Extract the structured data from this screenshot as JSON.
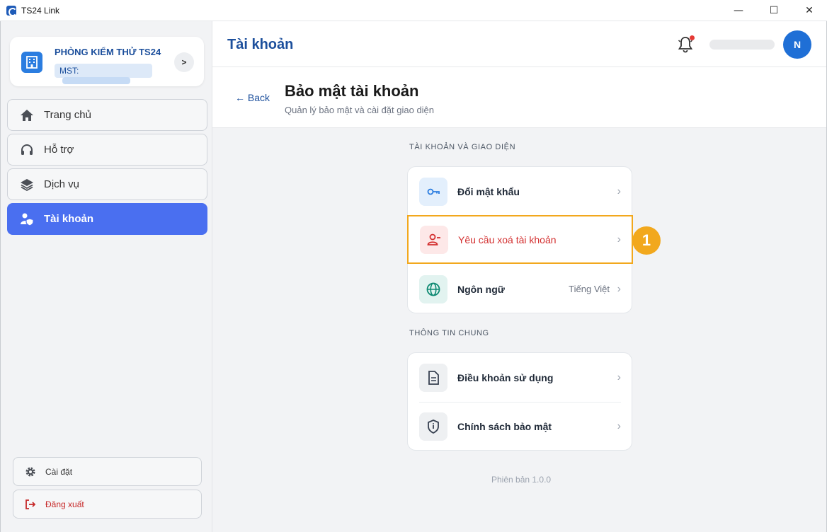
{
  "window": {
    "title": "TS24 Link",
    "minimize": "—",
    "maximize": "☐",
    "close": "✕"
  },
  "sidebar": {
    "org_name": "PHÒNG KIỂM THỬ TS24",
    "org_mst_label": "MST:",
    "org_arrow": ">",
    "items": [
      {
        "label": "Trang chủ",
        "icon": "home-icon"
      },
      {
        "label": "Hỗ trợ",
        "icon": "headset-icon"
      },
      {
        "label": "Dịch vụ",
        "icon": "layers-icon"
      },
      {
        "label": "Tài khoản",
        "icon": "user-shield-icon",
        "active": true
      }
    ],
    "settings_label": "Cài đặt",
    "logout_label": "Đăng xuất"
  },
  "header": {
    "title": "Tài khoản",
    "avatar_initial": "N"
  },
  "subheader": {
    "back_label": "← Back",
    "page_title": "Bảo mật tài khoản",
    "page_subtitle": "Quản lý bảo mật và cài đặt giao diện"
  },
  "sections": [
    {
      "label": "TÀI KHOẢN VÀ GIAO DIỆN",
      "rows": [
        {
          "label": "Đổi mật khẩu",
          "icon": "key-icon"
        },
        {
          "label": "Yêu cầu xoá tài khoản",
          "icon": "user-remove-icon",
          "highlighted": true
        },
        {
          "label": "Ngôn ngữ",
          "value": "Tiếng Việt",
          "icon": "globe-icon"
        }
      ]
    },
    {
      "label": "THÔNG TIN CHUNG",
      "rows": [
        {
          "label": "Điều khoản sử dụng",
          "icon": "document-icon"
        },
        {
          "label": "Chính sách bảo mật",
          "icon": "shield-icon"
        }
      ]
    }
  ],
  "step_badge": "1",
  "chevron": "›",
  "version": "Phiên bản 1.0.0",
  "colors": {
    "primary": "#1c4f9c",
    "active_nav": "#4a6ff0",
    "highlight": "#f2a81d",
    "danger": "#d32f2f"
  }
}
